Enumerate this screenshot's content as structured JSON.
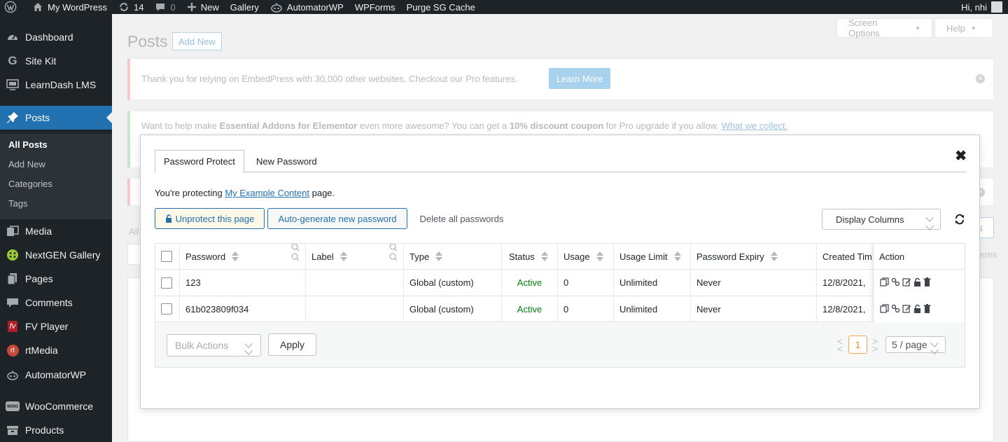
{
  "admin_bar": {
    "site_name": "My WordPress",
    "updates_count": "14",
    "comments_count": "0",
    "new_label": "New",
    "gallery_label": "Gallery",
    "automatorwp_label": "AutomatorWP",
    "wpforms_label": "WPForms",
    "purge_label": "Purge SG Cache",
    "greeting": "Hi, nhi"
  },
  "sidebar": {
    "items": [
      {
        "label": "Dashboard",
        "icon": "dashboard-icon"
      },
      {
        "label": "Site Kit",
        "icon": "google-g-icon"
      },
      {
        "label": "LearnDash LMS",
        "icon": "learndash-icon"
      },
      {
        "label": "Posts",
        "icon": "pushpin-icon"
      },
      {
        "label": "Media",
        "icon": "media-icon"
      },
      {
        "label": "NextGEN Gallery",
        "icon": "nextgen-icon"
      },
      {
        "label": "Pages",
        "icon": "pages-icon"
      },
      {
        "label": "Comments",
        "icon": "comment-bubble-icon"
      },
      {
        "label": "FV Player",
        "icon": "fv-player-icon"
      },
      {
        "label": "rtMedia",
        "icon": "rtmedia-icon"
      },
      {
        "label": "AutomatorWP",
        "icon": "automatorwp-icon"
      },
      {
        "label": "WooCommerce",
        "icon": "woocommerce-icon"
      },
      {
        "label": "Products",
        "icon": "products-icon"
      }
    ],
    "posts_submenu": [
      "All Posts",
      "Add New",
      "Categories",
      "Tags"
    ]
  },
  "page": {
    "title": "Posts",
    "add_new": "Add New",
    "screen_options": "Screen Options",
    "help": "Help",
    "notice_embedpress": "Thank you for relying on EmbedPress with 30,000 other websites. Checkout our Pro features.",
    "learn_more": "Learn More",
    "notice_ea_prefix": "Want to help make",
    "notice_ea_bold1": "Essential Addons for Elementor",
    "notice_ea_mid": "even more awesome? You can get a",
    "notice_ea_bold2": "10% discount coupon",
    "notice_ea_suffix": "for Pro upgrade if you allow.",
    "notice_ea_link": "What we collect.",
    "bg_all_fragment": "All",
    "bg_items_fragment": "ems",
    "bg_ts_fragment": "ts"
  },
  "modal": {
    "tabs": [
      "Password Protect",
      "New Password"
    ],
    "protecting_prefix": "You're protecting",
    "protecting_link": "My Example Content",
    "protecting_suffix": "page.",
    "unprotect_label": "Unprotect this page",
    "autogen_label": "Auto-generate new password",
    "delete_all_label": "Delete all passwords",
    "display_columns_label": "Display Columns",
    "table": {
      "columns": [
        "Password",
        "Label",
        "Type",
        "Status",
        "Usage",
        "Usage Limit",
        "Password Expiry",
        "Created Tim",
        "Action"
      ],
      "rows": [
        {
          "password": "123",
          "label": "",
          "type": "Global (custom)",
          "status": "Active",
          "usage": "0",
          "limit": "Unlimited",
          "expiry": "Never",
          "created": "12/8/2021,"
        },
        {
          "password": "61b023809f034",
          "label": "",
          "type": "Global (custom)",
          "status": "Active",
          "usage": "0",
          "limit": "Unlimited",
          "expiry": "Never",
          "created": "12/8/2021,"
        }
      ],
      "action_icons": [
        "copy-icon",
        "link-icon",
        "edit-icon",
        "lock-icon",
        "trash-icon"
      ]
    },
    "bulk_actions": "Bulk Actions",
    "apply_label": "Apply",
    "current_page": "1",
    "per_page": "5 / page"
  },
  "colors": {
    "admin_dark": "#1d2327",
    "accent_blue": "#2271b1",
    "active_green": "#00820b",
    "page_orange": "#e78c1b"
  }
}
